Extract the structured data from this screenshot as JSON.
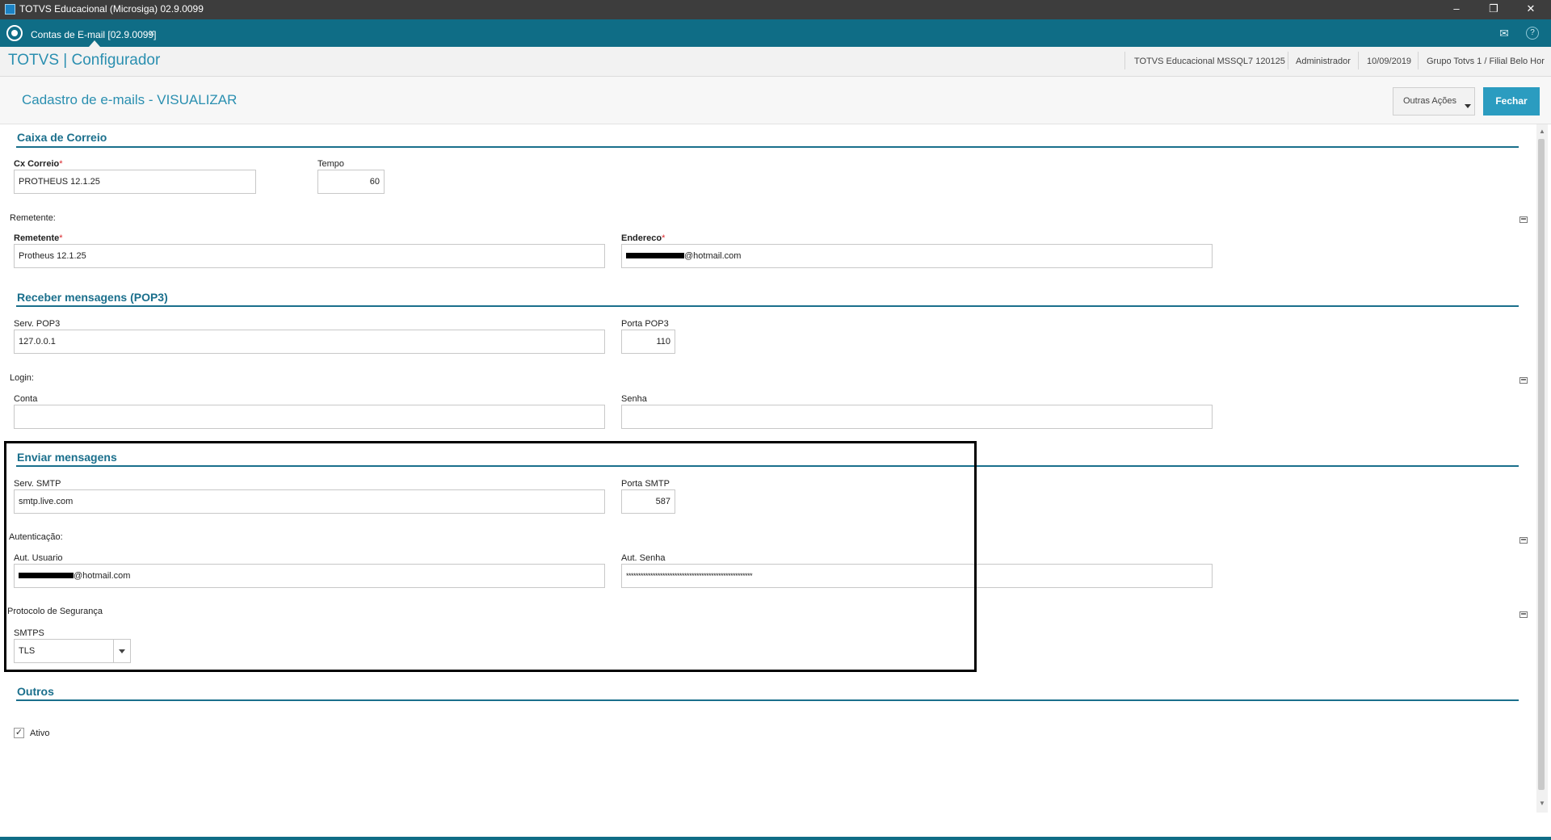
{
  "window": {
    "title": "TOTVS Educacional (Microsiga) 02.9.0099",
    "minimize": "–",
    "restore": "❐",
    "close": "✕"
  },
  "tabbar": {
    "tab_label": "Contas de E-mail [02.9.0099]",
    "tab_close": "×",
    "mail_icon": "✉",
    "help_icon": "?"
  },
  "app": {
    "title": "TOTVS | Configurador",
    "env": "TOTVS Educacional MSSQL7 120125",
    "user": "Administrador",
    "date": "10/09/2019",
    "branch": "Grupo Totvs 1 / Filial Belo Hor"
  },
  "form": {
    "title": "Cadastro de e-mails - VISUALIZAR",
    "outras_acoes": "Outras Ações",
    "fechar": "Fechar"
  },
  "caixa": {
    "section": "Caixa de Correio",
    "cx_label": "Cx Correio",
    "cx_value": "PROTHEUS 12.1.25",
    "tempo_label": "Tempo",
    "tempo_value": "60",
    "remetente_group": "Remetente:",
    "remetente_label": "Remetente",
    "remetente_value": "Protheus 12.1.25",
    "endereco_label": "Endereco",
    "endereco_suffix": "@hotmail.com"
  },
  "pop3": {
    "section": "Receber mensagens (POP3)",
    "serv_label": "Serv. POP3",
    "serv_value": "127.0.0.1",
    "porta_label": "Porta POP3",
    "porta_value": "110",
    "login_group": "Login:",
    "conta_label": "Conta",
    "conta_value": "",
    "senha_label": "Senha",
    "senha_value": ""
  },
  "smtp": {
    "section": "Enviar mensagens",
    "serv_label": "Serv. SMTP",
    "serv_value": "smtp.live.com",
    "porta_label": "Porta SMTP",
    "porta_value": "587",
    "auth_group": "Autenticação:",
    "aut_user_label": "Aut. Usuario",
    "aut_user_suffix": "@hotmail.com",
    "aut_senha_label": "Aut. Senha",
    "aut_senha_value": "****************************************************",
    "protocolo_group": "Protocolo de Segurança",
    "smtps_label": "SMTPS",
    "smtps_value": "TLS"
  },
  "outros": {
    "section": "Outros",
    "ativo_label": "Ativo",
    "ativo_checked": true,
    "check_glyph": "✓"
  },
  "colors": {
    "tabbar": "#0f6d86",
    "accent": "#2a8fb0",
    "section": "#1a6f8c",
    "required": "#d9262b",
    "button_primary": "#2b9cc0"
  }
}
